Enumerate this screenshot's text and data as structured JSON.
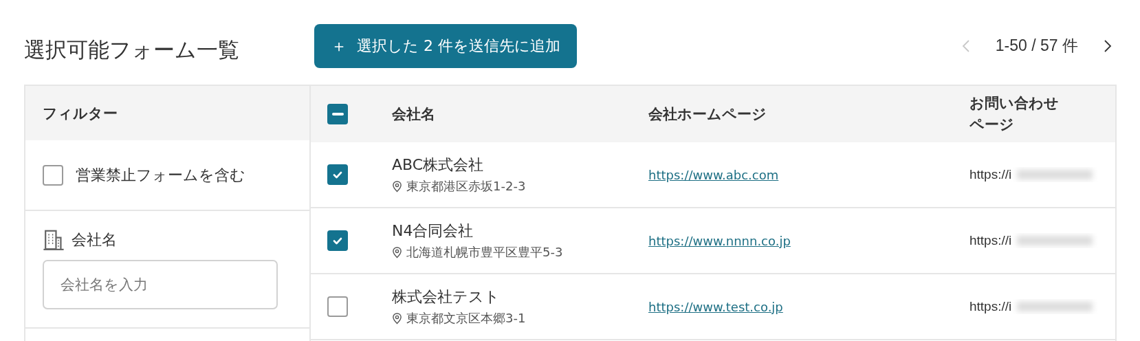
{
  "title": "選択可能フォーム一覧",
  "add_button": {
    "icon": "＋",
    "label": "選択した 2 件を送信先に追加"
  },
  "pagination": {
    "range": "1-50 / 57 件",
    "prev_disabled": true,
    "next_disabled": false
  },
  "filter": {
    "title": "フィルター",
    "exclude_checkbox": {
      "label": "営業禁止フォームを含む",
      "checked": false
    },
    "company_name": {
      "label": "会社名",
      "placeholder": "会社名を入力"
    }
  },
  "table": {
    "select_all": {
      "indeterminate": true
    },
    "columns": [
      "会社名",
      "会社ホームページ",
      "お問い合わせページ"
    ],
    "rows": [
      {
        "selected": true,
        "name": "ABC株式会社",
        "address": "東京都港区赤坂1-2-3",
        "homepage": "https://www.abc.com",
        "contact": "https://i"
      },
      {
        "selected": true,
        "name": "N4合同会社",
        "address": "北海道札幌市豊平区豊平5-3",
        "homepage": "https://www.nnnn.co.jp",
        "contact": "https://i"
      },
      {
        "selected": false,
        "name": "株式会社テスト",
        "address": "東京都文京区本郷3-1",
        "homepage": "https://www.test.co.jp",
        "contact": "https://i"
      }
    ]
  }
}
